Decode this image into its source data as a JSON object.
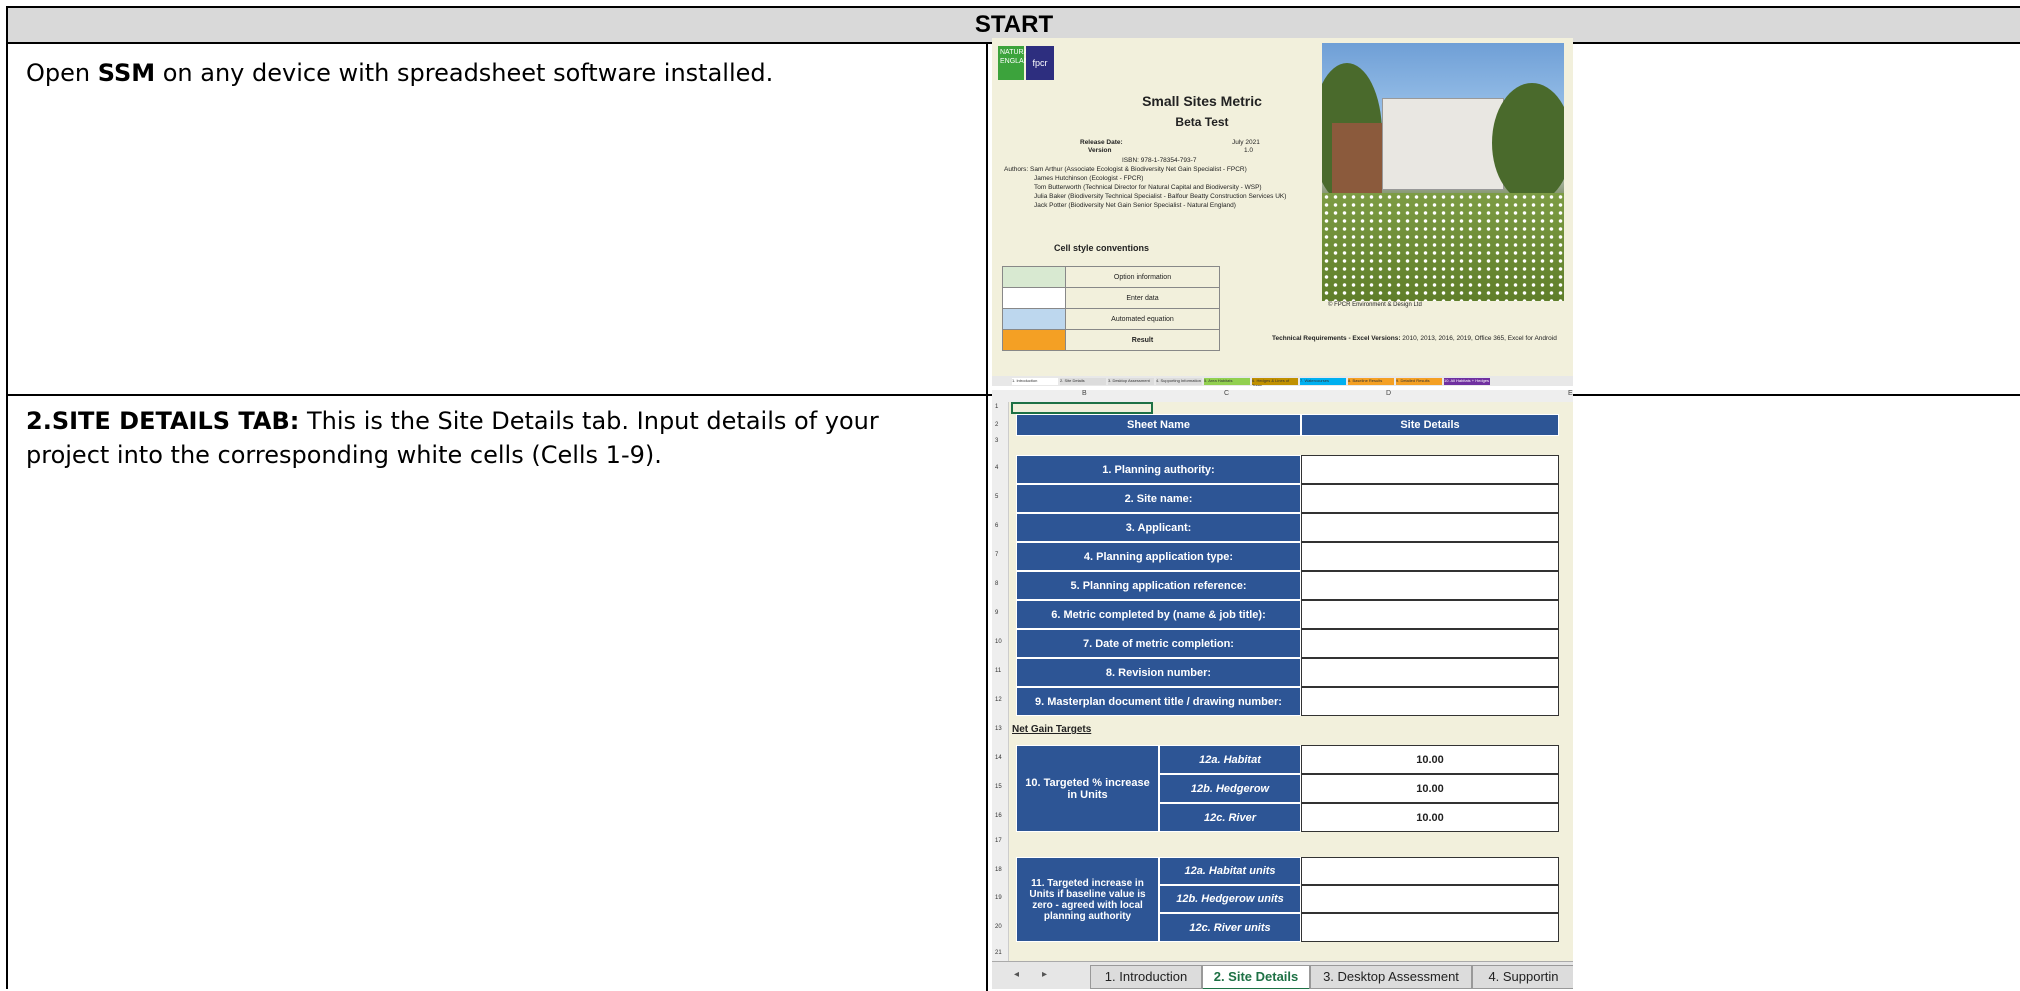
{
  "header": {
    "title": "START"
  },
  "rows": [
    {
      "text_pre": "Open ",
      "text_bold": "SSM",
      "text_post": " on any device with spreadsheet software installed."
    },
    {
      "text_bold": "2.SITE DETAILS TAB:",
      "text_post": " This is the Site Details tab. Input details of your project into the corresponding white cells (Cells 1-9)."
    }
  ],
  "screenshot1": {
    "logo_ne": "NATURAL ENGLAND",
    "logo_fpcr": "fpcr",
    "title": "Small Sites Metric",
    "subtitle": "Beta Test",
    "release_label": "Release Date:",
    "release_value": "July 2021",
    "version_label": "Version",
    "version_value": "1.0",
    "isbn": "ISBN: 978-1-78354-793-7",
    "authors": [
      "Authors:  Sam Arthur (Associate Ecologist & Biodiversity Net Gain Specialist - FPCR)",
      "James Hutchinson (Ecologist - FPCR)",
      "Tom Butterworth (Technical Director for Natural Capital and Biodiversity - WSP)",
      "Julia Baker (Biodiversity Technical Specialist - Balfour Beatty Construction Services UK)",
      "Jack Potter (Biodiversity Net Gain Senior Specialist - Natural England)"
    ],
    "cell_style_title": "Cell style conventions",
    "legend": [
      {
        "label": "Option information",
        "color": "#d8e9d1"
      },
      {
        "label": "Enter data",
        "color": "#ffffff"
      },
      {
        "label": "Automated equation",
        "color": "#bdd7ee"
      },
      {
        "label": "Result",
        "color": "#f4a024"
      }
    ],
    "copyright": "© FPCR Environment & Design Ltd",
    "tech_req_label": "Technical Requirements - Excel Versions:",
    "tech_req_value": "2010, 2013, 2016, 2019, Office 365, Excel for Android",
    "tabs": [
      {
        "label": "1. Introduction",
        "color": "#ffffff"
      },
      {
        "label": "2. Site Details",
        "color": "#dcdcdc"
      },
      {
        "label": "3. Desktop Assessment",
        "color": "#dcdcdc"
      },
      {
        "label": "4. Supporting Information",
        "color": "#dcdcdc"
      },
      {
        "label": "5. Area Habitats",
        "color": "#92d050"
      },
      {
        "label": "6. Hedges & Lines of Trees",
        "color": "#c09000"
      },
      {
        "label": "7. Watercourses",
        "color": "#00b0f0"
      },
      {
        "label": "8. Baseline Results",
        "color": "#f4a024"
      },
      {
        "label": "9. Detailed Results",
        "color": "#f4a024"
      },
      {
        "label": "10. All Habitats + Hedges",
        "color": "#7030a0"
      }
    ]
  },
  "screenshot2": {
    "col_headers": [
      "B",
      "C",
      "D",
      "E"
    ],
    "sheet_name_label": "Sheet Name",
    "sheet_name_value": "Site Details",
    "fields": [
      "1. Planning authority:",
      "2. Site name:",
      "3. Applicant:",
      "4. Planning application type:",
      "5. Planning application reference:",
      "6. Metric completed by (name & job title):",
      "7. Date of metric completion:",
      "8. Revision number:",
      "9. Masterplan document title / drawing number:"
    ],
    "net_gain_title": "Net Gain Targets",
    "target_pct_label": "10. Targeted % increase in Units",
    "target_pct_rows": [
      {
        "label": "12a. Habitat",
        "value": "10.00"
      },
      {
        "label": "12b. Hedgerow",
        "value": "10.00"
      },
      {
        "label": "12c. River",
        "value": "10.00"
      }
    ],
    "target_zero_label": "11. Targeted increase in Units if baseline value is zero - agreed with local planning authority",
    "target_zero_rows": [
      {
        "label": "12a. Habitat units"
      },
      {
        "label": "12b. Hedgerow units"
      },
      {
        "label": "12c. River units"
      }
    ],
    "row_numbers": [
      "1",
      "2",
      "3",
      "4",
      "5",
      "6",
      "7",
      "8",
      "9",
      "10",
      "11",
      "12",
      "13",
      "14",
      "15",
      "16",
      "17",
      "18",
      "19",
      "20",
      "21"
    ],
    "bottom_tabs": [
      "1. Introduction",
      "2. Site Details",
      "3. Desktop Assessment",
      "4. Supportin"
    ]
  }
}
